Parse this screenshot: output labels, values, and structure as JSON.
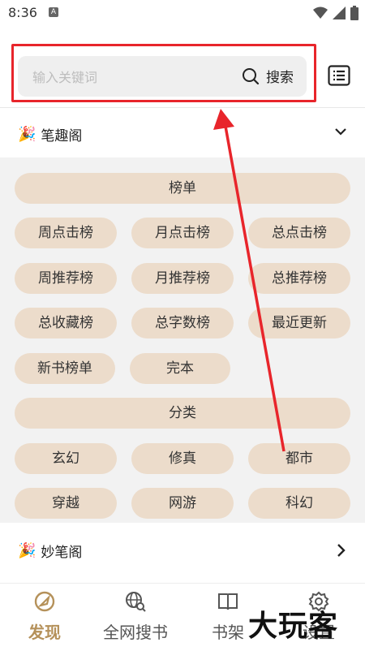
{
  "status": {
    "time": "8:36",
    "notif": "A"
  },
  "search": {
    "placeholder": "输入关键词",
    "button_label": "搜索"
  },
  "sections": [
    {
      "title": "笔趣阁",
      "expanded": true
    },
    {
      "title": "妙笔阁",
      "expanded": false
    }
  ],
  "rank_header": "榜单",
  "rank_items": [
    "周点击榜",
    "月点击榜",
    "总点击榜",
    "周推荐榜",
    "月推荐榜",
    "总推荐榜",
    "总收藏榜",
    "总字数榜",
    "最近更新",
    "新书榜单",
    "完本"
  ],
  "category_header": "分类",
  "category_items": [
    "玄幻",
    "修真",
    "都市",
    "穿越",
    "网游",
    "科幻"
  ],
  "nav": [
    {
      "label": "发现",
      "icon": "compass-icon",
      "active": true
    },
    {
      "label": "全网搜书",
      "icon": "globe-search-icon",
      "active": false
    },
    {
      "label": "书架",
      "icon": "book-icon",
      "active": false
    },
    {
      "label": "设置",
      "icon": "gear-icon",
      "active": false
    }
  ],
  "watermark": "大玩客",
  "colors": {
    "accent": "#b5915a",
    "chip": "#ecdccb",
    "highlight": "#e8252b"
  }
}
